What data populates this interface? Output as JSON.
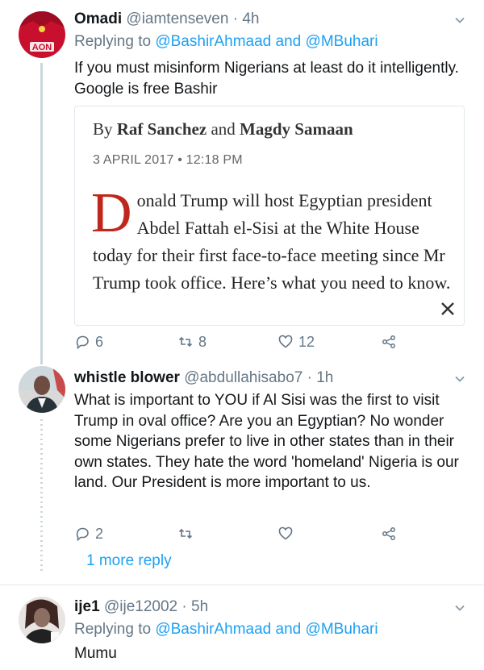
{
  "tweets": [
    {
      "name": "Omadi",
      "handle": "@iamtenseven",
      "time": "· 4h",
      "replying_prefix": "Replying to ",
      "mention1": "@BashirAhmaad",
      "and": " and ",
      "mention2": "@MBuhari",
      "text": "If you must misinform Nigerians at least do it intelligently. Google is free Bashir",
      "card": {
        "by": "By ",
        "author1": "Raf Sanchez",
        "and": " and ",
        "author2": "Magdy Samaan",
        "date": "3 APRIL 2017 • 12:18 PM",
        "dropcap": "D",
        "article": "onald Trump will host Egyptian president Abdel Fattah el-Sisi at the White House today for their first face-to-face meeting since Mr Trump took office. Here’s what you need to know."
      },
      "replies": "6",
      "retweets": "8",
      "likes": "12"
    },
    {
      "name": "whistle blower",
      "handle": "@abdullahisabo7",
      "time": "· 1h",
      "text": "What is important to YOU if Al Sisi was the first to visit Trump in oval office?  Are you an Egyptian? No wonder some Nigerians prefer to live in other states than in their own states. They hate the word 'homeland' Nigeria is our land.  Our President is more important to us.",
      "replies": "2",
      "more_reply": "1 more reply"
    },
    {
      "name": "ije1",
      "handle": "@ije12002",
      "time": "· 5h",
      "replying_prefix": "Replying to ",
      "mention1": "@BashirAhmaad",
      "and": " and ",
      "mention2": "@MBuhari",
      "text": "Mumu"
    }
  ],
  "icons": [
    "reply-icon",
    "retweet-icon",
    "like-icon",
    "share-icon",
    "chevron-down-icon",
    "close-icon"
  ],
  "colors": {
    "link": "#1da1f2",
    "muted": "#657786",
    "dropcap": "#c0271c"
  }
}
